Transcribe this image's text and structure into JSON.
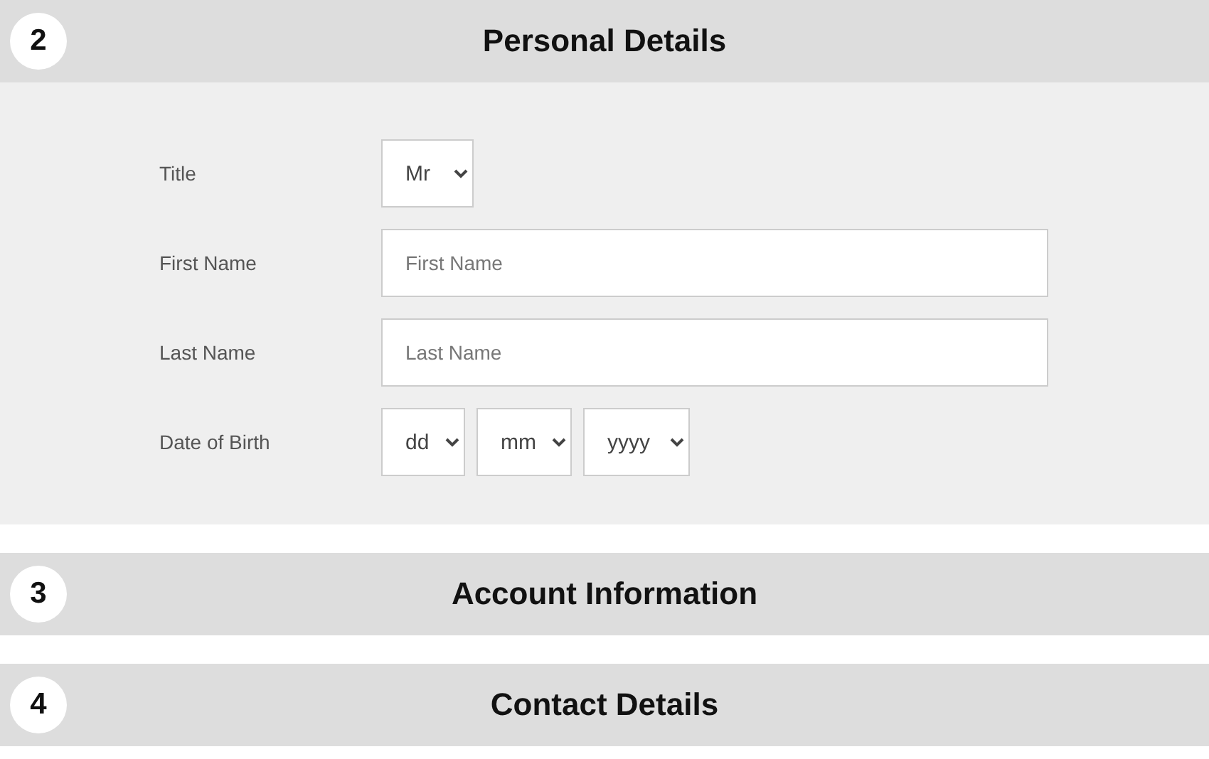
{
  "sections": [
    {
      "number": "2",
      "title": "Personal Details",
      "fields": [
        {
          "kind": "select",
          "label": "Title",
          "selects": [
            "Mr"
          ]
        },
        {
          "kind": "text",
          "label": "First Name",
          "placeholder": "First Name"
        },
        {
          "kind": "text",
          "label": "Last Name",
          "placeholder": "Last Name"
        },
        {
          "kind": "select",
          "label": "Date of Birth",
          "selects": [
            "dd",
            "mm",
            "yyyy"
          ]
        }
      ]
    },
    {
      "number": "3",
      "title": "Account Information"
    },
    {
      "number": "4",
      "title": "Contact Details"
    }
  ]
}
